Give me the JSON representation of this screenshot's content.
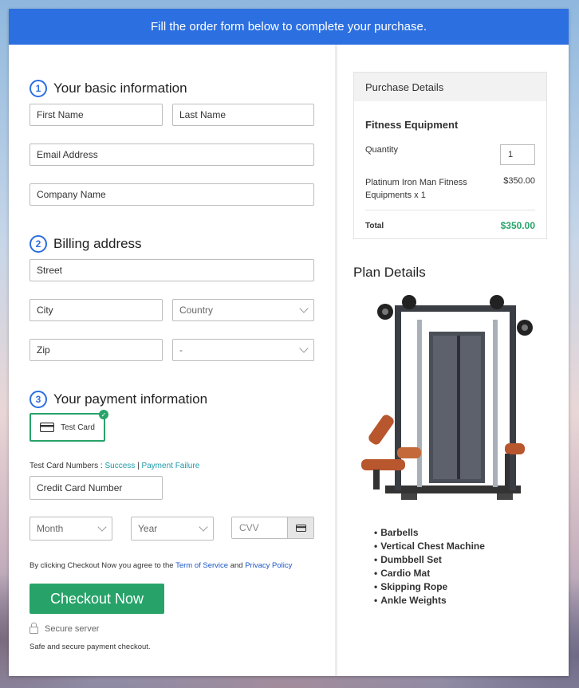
{
  "banner": {
    "text": "Fill the order form below to complete your purchase."
  },
  "basic_info": {
    "step": "1",
    "title": "Your basic information",
    "first_name": "First Name",
    "last_name": "Last Name",
    "email": "Email Address",
    "company": "Company Name"
  },
  "billing": {
    "step": "2",
    "title": "Billing address",
    "street": "Street",
    "city": "City",
    "country": "Country",
    "zip": "Zip",
    "state": "-"
  },
  "payment": {
    "step": "3",
    "title": "Your payment information",
    "test_card_label": "Test Card",
    "test_numbers_prefix": "Test Card Numbers :",
    "success_link": "Success",
    "separator": "|",
    "failure_link": "Payment Failure",
    "card_number": "Credit Card Number",
    "month": "Month",
    "year": "Year",
    "cvv": "CVV"
  },
  "terms": {
    "prefix": "By clicking Checkout Now you agree to the",
    "tos": "Term of Service",
    "and": "and",
    "privacy": "Privacy Policy"
  },
  "checkout": {
    "label": "Checkout Now"
  },
  "secure": {
    "label": "Secure server"
  },
  "safe_note": "Safe and secure payment checkout.",
  "purchase": {
    "header": "Purchase Details",
    "product_name": "Fitness Equipment",
    "quantity_label": "Quantity",
    "quantity_value": "1",
    "item_line1": "Platinum Iron Man Fitness",
    "item_line2": "Equipments x 1",
    "item_price": "$350.00",
    "total_label": "Total",
    "total_value": "$350.00"
  },
  "plan": {
    "title": "Plan Details",
    "features": [
      "Barbells",
      "Vertical Chest Machine",
      "Dumbbell Set",
      "Cardio Mat",
      "Skipping Rope",
      "Ankle Weights"
    ]
  },
  "colors": {
    "primary": "#2c6fe0",
    "success": "#27a36a",
    "link": "#1b9aaa"
  }
}
